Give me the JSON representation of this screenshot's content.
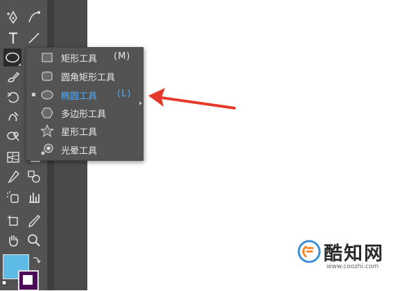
{
  "flyout_menu": {
    "items": [
      {
        "label": "矩形工具",
        "shortcut": "(M)",
        "icon": "rectangle-icon",
        "selected": false
      },
      {
        "label": "圆角矩形工具",
        "shortcut": "",
        "icon": "rounded-rectangle-icon",
        "selected": false
      },
      {
        "label": "椭圆工具",
        "shortcut": "(L)",
        "icon": "ellipse-icon",
        "selected": true
      },
      {
        "label": "多边形工具",
        "shortcut": "",
        "icon": "polygon-icon",
        "selected": false
      },
      {
        "label": "星形工具",
        "shortcut": "",
        "icon": "star-icon",
        "selected": false
      },
      {
        "label": "光晕工具",
        "shortcut": "",
        "icon": "flare-icon",
        "selected": false
      }
    ]
  },
  "toolbar": {
    "tools": [
      "pen-tool-icon",
      "curvature-tool-icon",
      "type-tool-icon",
      "line-segment-tool-icon",
      "ellipse-tool-icon",
      "paintbrush-tool-icon",
      "rotate-tool-icon",
      "warp-tool-icon",
      "shape-builder-tool-icon",
      "perspective-grid-tool-icon",
      "eyedropper-tool-icon",
      "blend-tool-icon",
      "symbol-sprayer-tool-icon",
      "column-graph-tool-icon",
      "artboard-tool-icon",
      "slice-tool-icon",
      "hand-tool-icon",
      "zoom-tool-icon"
    ],
    "fill_color": "#5dbbe6",
    "stroke_color": "#4b0c57"
  },
  "annotation": {
    "arrow_color": "#e53a2b"
  },
  "watermark": {
    "title": "酷知网",
    "url": "www.coozhi.com"
  },
  "colors": {
    "toolbar_bg": "#535353",
    "menu_text": "#e9e9e9",
    "selected_text": "#5aa9ee"
  }
}
